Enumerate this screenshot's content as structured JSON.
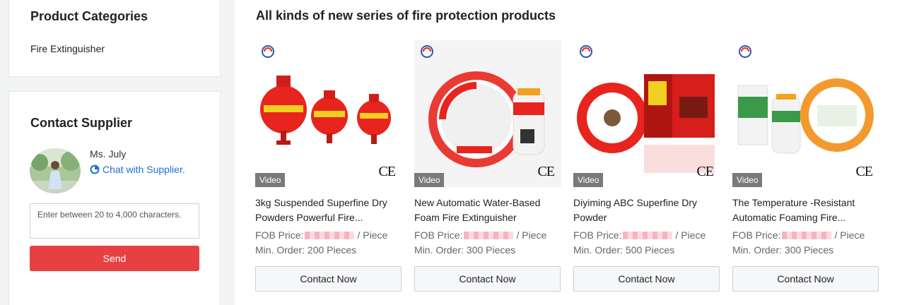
{
  "sidebar": {
    "categories": {
      "title": "Product Categories",
      "items": [
        "Fire Extinguisher"
      ]
    },
    "contact": {
      "title": "Contact Supplier",
      "supplier_name": "Ms. July",
      "chat_label": "Chat with Supplier.",
      "message_placeholder": "Enter between 20 to 4,000 characters.",
      "send_label": "Send"
    }
  },
  "main": {
    "section_title": "All kinds of new series of fire protection products",
    "products": [
      {
        "name": "3kg Suspended Superfine Dry Powders Powerful Fire...",
        "video_label": "Video",
        "ce_label": "CE",
        "price_prefix": "FOB Price:",
        "price_unit": "/ Piece",
        "min_order": "Min. Order: 200 Pieces",
        "contact_label": "Contact Now"
      },
      {
        "name": "New Automatic Water-Based Foam Fire Extinguisher",
        "video_label": "Video",
        "ce_label": "CE",
        "price_prefix": "FOB Price:",
        "price_unit": "/ Piece",
        "min_order": "Min. Order: 300 Pieces",
        "contact_label": "Contact Now"
      },
      {
        "name": "Diyiming ABC Superfine Dry Powder",
        "video_label": "Video",
        "ce_label": "CE",
        "price_prefix": "FOB Price:",
        "price_unit": "/ Piece",
        "min_order": "Min. Order: 500 Pieces",
        "contact_label": "Contact Now"
      },
      {
        "name": "The Temperature -Resistant Automatic Foaming Fire...",
        "video_label": "Video",
        "ce_label": "CE",
        "price_prefix": "FOB Price:",
        "price_unit": "/ Piece",
        "min_order": "Min. Order: 300 Pieces",
        "contact_label": "Contact Now"
      }
    ]
  },
  "colors": {
    "accent_red": "#e84040",
    "link_blue": "#1f6fd1",
    "product_red": "#e8241f"
  },
  "icons": {
    "chat": "chat-icon",
    "logo": "brand-logo-icon"
  }
}
